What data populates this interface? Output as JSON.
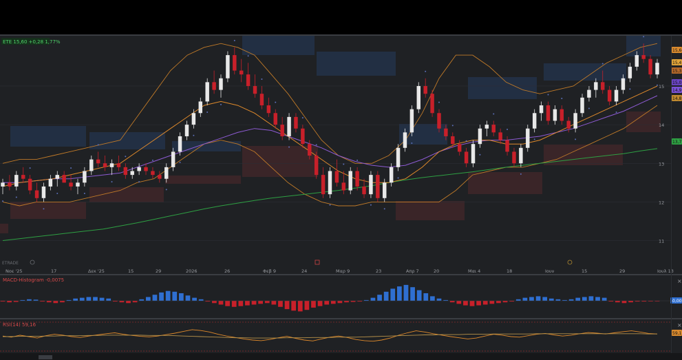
{
  "chart_data": [
    {
      "type": "candlestick",
      "legend": {
        "symbol": "ETE",
        "price": "15,60",
        "change": "+0,28",
        "change_pct": "1,77%"
      },
      "watermark": "ETRADE",
      "y_ticks": [
        "15",
        "14",
        "13",
        "12",
        "11"
      ],
      "ylim": [
        10.6,
        16.3
      ],
      "x_ticks": [
        "Νοε '25",
        "17",
        "Δεκ '25",
        "15",
        "29",
        "2026",
        "26",
        "Φεβ 9",
        "24",
        "Μαρ 9",
        "23",
        "Απρ 7",
        "20",
        "Μαι 4",
        "18",
        "Ιουν",
        "15",
        "29",
        "Ιουλ 13"
      ],
      "price_tags": [
        "15,60",
        "15,4",
        "15,3",
        "15,0",
        "14,9",
        "14,8",
        "13,7"
      ],
      "candles_ohlc": [
        [
          12.4,
          12.6,
          12.2,
          12.5
        ],
        [
          12.5,
          12.7,
          12.3,
          12.4
        ],
        [
          12.4,
          12.8,
          12.3,
          12.7
        ],
        [
          12.7,
          12.9,
          12.5,
          12.6
        ],
        [
          12.6,
          12.7,
          12.2,
          12.3
        ],
        [
          12.3,
          12.5,
          12.0,
          12.1
        ],
        [
          12.1,
          12.5,
          12.0,
          12.4
        ],
        [
          12.4,
          12.7,
          12.3,
          12.6
        ],
        [
          12.6,
          12.8,
          12.4,
          12.7
        ],
        [
          12.7,
          12.8,
          12.5,
          12.5
        ],
        [
          12.5,
          12.7,
          12.3,
          12.4
        ],
        [
          12.4,
          12.6,
          12.2,
          12.5
        ],
        [
          12.5,
          12.9,
          12.4,
          12.8
        ],
        [
          12.8,
          13.2,
          12.7,
          13.1
        ],
        [
          13.1,
          13.3,
          12.9,
          13.0
        ],
        [
          13.0,
          13.2,
          12.8,
          12.9
        ],
        [
          12.9,
          13.1,
          12.7,
          13.0
        ],
        [
          13.0,
          13.2,
          12.8,
          12.9
        ],
        [
          12.9,
          13.0,
          12.6,
          12.7
        ],
        [
          12.7,
          12.9,
          12.6,
          12.8
        ],
        [
          12.8,
          13.0,
          12.7,
          12.9
        ],
        [
          12.9,
          13.0,
          12.7,
          12.8
        ],
        [
          12.8,
          12.9,
          12.6,
          12.7
        ],
        [
          12.7,
          12.8,
          12.5,
          12.6
        ],
        [
          12.6,
          13.0,
          12.5,
          12.9
        ],
        [
          12.9,
          13.4,
          12.8,
          13.3
        ],
        [
          13.3,
          13.8,
          13.2,
          13.7
        ],
        [
          13.7,
          14.1,
          13.6,
          14.0
        ],
        [
          14.0,
          14.4,
          13.9,
          14.3
        ],
        [
          14.3,
          14.7,
          14.2,
          14.6
        ],
        [
          14.6,
          15.2,
          14.5,
          15.1
        ],
        [
          15.1,
          15.4,
          14.8,
          14.9
        ],
        [
          14.9,
          15.3,
          14.7,
          15.2
        ],
        [
          15.2,
          15.9,
          15.1,
          15.8
        ],
        [
          15.8,
          16.0,
          15.3,
          15.4
        ],
        [
          15.4,
          15.7,
          15.1,
          15.3
        ],
        [
          15.3,
          15.6,
          14.9,
          15.0
        ],
        [
          15.0,
          15.3,
          14.7,
          14.8
        ],
        [
          14.8,
          15.0,
          14.4,
          14.5
        ],
        [
          14.5,
          14.7,
          14.2,
          14.3
        ],
        [
          14.3,
          14.4,
          13.9,
          14.0
        ],
        [
          14.0,
          14.2,
          13.6,
          13.7
        ],
        [
          13.7,
          14.3,
          13.6,
          14.2
        ],
        [
          14.2,
          14.3,
          13.8,
          13.9
        ],
        [
          13.9,
          14.0,
          13.4,
          13.5
        ],
        [
          13.5,
          13.6,
          13.1,
          13.2
        ],
        [
          13.2,
          13.3,
          12.6,
          12.7
        ],
        [
          12.7,
          12.9,
          12.1,
          12.2
        ],
        [
          12.2,
          12.9,
          12.1,
          12.8
        ],
        [
          12.8,
          13.1,
          12.4,
          12.5
        ],
        [
          12.5,
          12.8,
          12.2,
          12.3
        ],
        [
          12.3,
          12.9,
          12.2,
          12.8
        ],
        [
          12.8,
          12.9,
          12.3,
          12.4
        ],
        [
          12.4,
          12.6,
          12.1,
          12.2
        ],
        [
          12.2,
          12.8,
          12.1,
          12.7
        ],
        [
          12.7,
          12.8,
          12.0,
          12.1
        ],
        [
          12.1,
          12.6,
          12.0,
          12.5
        ],
        [
          12.5,
          13.0,
          12.4,
          12.9
        ],
        [
          12.9,
          13.5,
          12.8,
          13.4
        ],
        [
          13.4,
          13.9,
          13.3,
          13.8
        ],
        [
          13.8,
          14.5,
          13.7,
          14.4
        ],
        [
          14.4,
          15.1,
          14.3,
          15.0
        ],
        [
          15.0,
          15.2,
          14.7,
          14.8
        ],
        [
          14.8,
          14.9,
          14.2,
          14.3
        ],
        [
          14.3,
          14.4,
          13.8,
          13.9
        ],
        [
          13.9,
          14.0,
          13.6,
          13.7
        ],
        [
          13.7,
          13.8,
          13.4,
          13.5
        ],
        [
          13.5,
          13.6,
          13.2,
          13.3
        ],
        [
          13.3,
          13.4,
          12.9,
          13.0
        ],
        [
          13.0,
          13.6,
          12.9,
          13.5
        ],
        [
          13.5,
          14.0,
          13.4,
          13.9
        ],
        [
          13.9,
          14.1,
          13.7,
          14.0
        ],
        [
          14.0,
          14.1,
          13.7,
          13.8
        ],
        [
          13.8,
          13.9,
          13.5,
          13.6
        ],
        [
          13.6,
          13.7,
          13.2,
          13.3
        ],
        [
          13.3,
          13.4,
          12.9,
          13.0
        ],
        [
          13.0,
          13.5,
          12.9,
          13.4
        ],
        [
          13.4,
          14.0,
          13.3,
          13.9
        ],
        [
          13.9,
          14.4,
          13.8,
          14.3
        ],
        [
          14.3,
          14.6,
          14.1,
          14.5
        ],
        [
          14.5,
          14.6,
          14.0,
          14.1
        ],
        [
          14.1,
          14.5,
          14.0,
          14.4
        ],
        [
          14.4,
          14.5,
          14.0,
          14.1
        ],
        [
          14.1,
          14.2,
          13.8,
          13.9
        ],
        [
          13.9,
          14.4,
          13.8,
          14.3
        ],
        [
          14.3,
          14.8,
          14.2,
          14.7
        ],
        [
          14.7,
          15.0,
          14.6,
          14.9
        ],
        [
          14.9,
          15.2,
          14.7,
          15.1
        ],
        [
          15.1,
          15.4,
          14.8,
          14.9
        ],
        [
          14.9,
          15.0,
          14.5,
          14.6
        ],
        [
          14.6,
          15.0,
          14.5,
          14.9
        ],
        [
          14.9,
          15.3,
          14.8,
          15.2
        ],
        [
          15.2,
          15.6,
          15.1,
          15.5
        ],
        [
          15.5,
          15.9,
          15.4,
          15.8
        ],
        [
          15.8,
          16.1,
          15.6,
          15.7
        ],
        [
          15.7,
          15.8,
          15.2,
          15.3
        ],
        [
          15.3,
          15.7,
          15.2,
          15.6
        ]
      ],
      "series": [
        {
          "name": "",
          "color": "#2ea043",
          "values": [
            11.0,
            11.05,
            11.1,
            11.15,
            11.2,
            11.25,
            11.3,
            11.38,
            11.46,
            11.55,
            11.64,
            11.73,
            11.82,
            11.9,
            11.97,
            12.04,
            12.1,
            12.15,
            12.2,
            12.25,
            12.3,
            12.36,
            12.42,
            12.5,
            12.57,
            12.63,
            12.68,
            12.73,
            12.78,
            12.84,
            12.9,
            12.95,
            13.0,
            13.05,
            13.1,
            13.15,
            13.2,
            13.25,
            13.32,
            13.38
          ]
        },
        {
          "name": "",
          "color": "#8e5bd4",
          "values": [
            12.5,
            12.5,
            12.55,
            12.6,
            12.6,
            12.65,
            12.7,
            12.75,
            12.9,
            13.05,
            13.2,
            13.35,
            13.5,
            13.65,
            13.8,
            13.9,
            13.85,
            13.7,
            13.55,
            13.4,
            13.2,
            13.05,
            12.95,
            12.9,
            12.95,
            13.1,
            13.3,
            13.45,
            13.55,
            13.6,
            13.6,
            13.65,
            13.7,
            13.8,
            13.9,
            14.05,
            14.2,
            14.35,
            14.55,
            14.75
          ]
        },
        {
          "name": "",
          "color": "#e08a2b",
          "values": [
            12.4,
            12.5,
            12.55,
            12.6,
            12.7,
            12.8,
            12.9,
            13.0,
            13.3,
            13.6,
            13.9,
            14.2,
            14.5,
            14.6,
            14.5,
            14.3,
            14.0,
            13.7,
            13.4,
            13.1,
            12.8,
            12.6,
            12.5,
            12.5,
            12.6,
            12.9,
            13.3,
            13.5,
            13.6,
            13.6,
            13.5,
            13.5,
            13.6,
            13.8,
            14.0,
            14.2,
            14.4,
            14.6,
            14.8,
            15.0
          ]
        }
      ],
      "bollinger": {
        "upper": [
          13.0,
          13.1,
          13.1,
          13.2,
          13.3,
          13.4,
          13.5,
          13.6,
          14.2,
          14.8,
          15.4,
          15.8,
          16.0,
          16.1,
          16.0,
          15.8,
          15.3,
          14.8,
          14.2,
          13.6,
          13.2,
          13.0,
          13.0,
          13.2,
          13.6,
          14.3,
          15.2,
          15.8,
          15.8,
          15.5,
          15.1,
          14.9,
          14.8,
          14.9,
          15.0,
          15.3,
          15.6,
          15.8,
          16.0,
          16.1
        ],
        "lower": [
          12.0,
          11.9,
          12.0,
          12.0,
          12.0,
          12.1,
          12.2,
          12.3,
          12.5,
          12.6,
          12.9,
          13.2,
          13.5,
          13.6,
          13.5,
          13.3,
          12.9,
          12.5,
          12.2,
          12.0,
          11.9,
          11.9,
          12.0,
          12.0,
          12.0,
          12.0,
          12.0,
          12.3,
          12.7,
          12.8,
          12.9,
          12.9,
          13.0,
          13.1,
          13.3,
          13.5,
          13.7,
          13.9,
          14.2,
          14.5
        ]
      }
    },
    {
      "type": "bar",
      "label": "MACD-Histogram",
      "value": "-0,0075",
      "tag": "-0,007",
      "values": [
        -0.01,
        -0.02,
        -0.015,
        0.01,
        0.02,
        0.015,
        -0.01,
        -0.02,
        -0.03,
        -0.02,
        0.01,
        0.03,
        0.04,
        0.05,
        0.05,
        0.04,
        0.03,
        -0.01,
        -0.02,
        -0.03,
        -0.02,
        0.02,
        0.05,
        0.08,
        0.11,
        0.13,
        0.12,
        0.1,
        0.07,
        0.04,
        0.02,
        -0.01,
        -0.03,
        -0.05,
        -0.07,
        -0.08,
        -0.07,
        -0.06,
        -0.05,
        -0.04,
        -0.03,
        -0.05,
        -0.08,
        -0.11,
        -0.13,
        -0.14,
        -0.12,
        -0.09,
        -0.07,
        -0.05,
        -0.04,
        -0.03,
        -0.02,
        -0.015,
        -0.01,
        0.01,
        0.04,
        0.08,
        0.12,
        0.16,
        0.19,
        0.21,
        0.18,
        0.14,
        0.1,
        0.06,
        0.03,
        0.01,
        -0.02,
        -0.04,
        -0.06,
        -0.07,
        -0.06,
        -0.05,
        -0.04,
        -0.03,
        -0.02,
        -0.01,
        0.02,
        0.04,
        0.05,
        0.06,
        0.05,
        0.03,
        0.02,
        0.01,
        0.02,
        0.04,
        0.05,
        0.06,
        0.05,
        0.04,
        -0.01,
        -0.02,
        -0.03,
        -0.02,
        -0.01,
        -0.01,
        -0.008,
        -0.0075
      ]
    },
    {
      "type": "line",
      "label": "RSI(14)",
      "value": "59,16",
      "tag": "59,1",
      "ylim": [
        0,
        100
      ],
      "series": [
        {
          "name": "",
          "color": "#e08a2b",
          "values": [
            52,
            48,
            55,
            50,
            45,
            53,
            58,
            55,
            50,
            47,
            52,
            56,
            60,
            63,
            58,
            54,
            51,
            49,
            52,
            57,
            62,
            68,
            74,
            71,
            66,
            58,
            52,
            47,
            42,
            38,
            36,
            40,
            46,
            51,
            44,
            38,
            35,
            42,
            48,
            52,
            47,
            40,
            36,
            34,
            38,
            45,
            55,
            63,
            70,
            66,
            60,
            55,
            50,
            46,
            42,
            45,
            52,
            58,
            55,
            50,
            48,
            53,
            58,
            61,
            56,
            52,
            55,
            60,
            64,
            62,
            59,
            63,
            67,
            70,
            66,
            61,
            59
          ]
        },
        {
          "name": "",
          "color": "#b8924a",
          "values": [
            50,
            50,
            51,
            51,
            51,
            52,
            52,
            53,
            53,
            53,
            54,
            54,
            55,
            55,
            55,
            55,
            55,
            54,
            54,
            54,
            53,
            52,
            51,
            50,
            49,
            48,
            47,
            46,
            46,
            45,
            45,
            45,
            45,
            46,
            46,
            46,
            47,
            47,
            47,
            48,
            48,
            48,
            49,
            50,
            51,
            52,
            53,
            54,
            55,
            56,
            56,
            57,
            57,
            57,
            58,
            58,
            58,
            59,
            59,
            59,
            59,
            59,
            60,
            60,
            60,
            60,
            60,
            60,
            60,
            60,
            60,
            60,
            60,
            60,
            60,
            59,
            59
          ]
        }
      ]
    }
  ]
}
